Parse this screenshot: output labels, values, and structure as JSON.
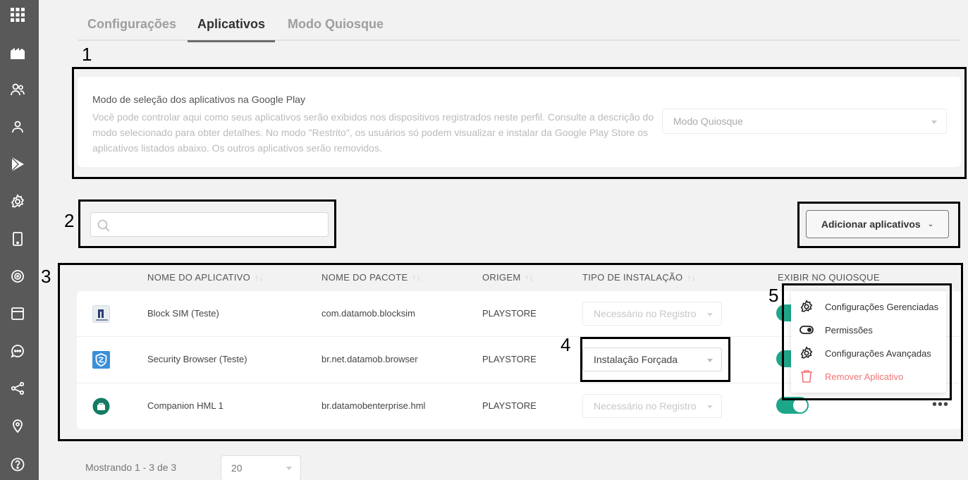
{
  "tabs": [
    {
      "label": "Configurações"
    },
    {
      "label": "Aplicativos"
    },
    {
      "label": "Modo Quiosque"
    }
  ],
  "annotations": [
    "1",
    "2",
    "3",
    "4",
    "5"
  ],
  "mode": {
    "title": "Modo de seleção dos aplicativos na Google Play",
    "description": "Você pode controlar aqui como seus aplicativos serão exibidos nos dispositivos registrados neste perfil. Consulte a descrição do modo selecionado para obter detalhes. No modo \"Restrito\", os usuários só podem visualizar e instalar da Google Play Store os aplicativos listados abaixo. Os outros aplicativos serão removidos.",
    "selected": "Modo Quiosque"
  },
  "search": {
    "placeholder": "",
    "value": ""
  },
  "add_button": {
    "label": "Adicionar aplicativos"
  },
  "table": {
    "headers": {
      "app_name": "NOME DO APLICATIVO",
      "package": "NOME DO PACOTE",
      "origin": "ORIGEM",
      "install_type": "TIPO DE INSTALAÇÃO",
      "kiosk": "EXIBIR NO QUIOSQUE"
    },
    "rows": [
      {
        "name": "Block SIM (Teste)",
        "package": "com.datamob.blocksim",
        "origin": "PLAYSTORE",
        "install": "Necessário no Registro",
        "kiosk_on": true
      },
      {
        "name": "Security Browser (Teste)",
        "package": "br.net.datamob.browser",
        "origin": "PLAYSTORE",
        "install": "Instalação Forçada",
        "kiosk_on": true
      },
      {
        "name": "Companion HML 1",
        "package": "br.datamobenterprise.hml",
        "origin": "PLAYSTORE",
        "install": "Necessário no Registro",
        "kiosk_on": true
      }
    ]
  },
  "context_menu": {
    "items": [
      {
        "label": "Configurações Gerenciadas",
        "icon": "gear-icon"
      },
      {
        "label": "Permissões",
        "icon": "toggle-icon"
      },
      {
        "label": "Configurações Avançadas",
        "icon": "gear-icon"
      },
      {
        "label": "Remover Aplicativo",
        "icon": "trash-icon"
      }
    ]
  },
  "footer": {
    "showing": "Mostrando 1 - 3 de 3",
    "page_size": "20"
  },
  "colors": {
    "sidebar": "#595959",
    "toggle_on": "#1ea68a",
    "danger": "#f27474"
  }
}
